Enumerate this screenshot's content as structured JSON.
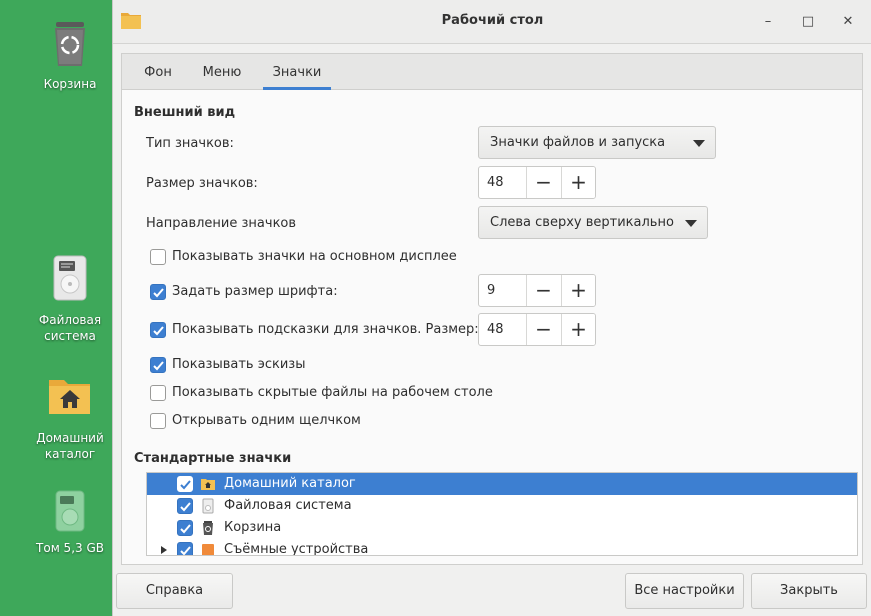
{
  "desktop": {
    "icons": [
      {
        "label": "Корзина",
        "icon": "trash-icon"
      },
      {
        "label": "Файловая система",
        "icon": "drive-icon"
      },
      {
        "label": "Домашний каталог",
        "icon": "home-folder-icon"
      },
      {
        "label": "Том 5,3 GB",
        "icon": "volume-icon"
      }
    ]
  },
  "window": {
    "title": "Рабочий стол",
    "controls": {
      "minimize": "–",
      "maximize": "□",
      "close": "✕"
    },
    "tabs": [
      {
        "label": "Фон",
        "active": false
      },
      {
        "label": "Меню",
        "active": false
      },
      {
        "label": "Значки",
        "active": true
      }
    ],
    "appearance": {
      "title": "Внешний вид",
      "icon_type_label": "Тип значков:",
      "icon_type_value": "Значки файлов и запуска",
      "icon_size_label": "Размер значков:",
      "icon_size_value": "48",
      "direction_label": "Направление значков",
      "direction_value": "Слева сверху вертикально",
      "checks": [
        {
          "label": "Показывать значки на основном дисплее",
          "checked": false
        },
        {
          "label": "Задать размер шрифта:",
          "checked": true,
          "value": "9"
        },
        {
          "label": "Показывать подсказки для значков. Размер:",
          "checked": true,
          "value": "48"
        },
        {
          "label": "Показывать эскизы",
          "checked": true
        },
        {
          "label": "Показывать скрытые файлы на рабочем столе",
          "checked": false
        },
        {
          "label": "Открывать одним щелчком",
          "checked": false
        }
      ]
    },
    "standard_icons": {
      "title": "Стандартные значки",
      "items": [
        {
          "label": "Домашний каталог",
          "checked": true,
          "selected": true,
          "icon": "home-folder-icon"
        },
        {
          "label": "Файловая система",
          "checked": true,
          "selected": false,
          "icon": "drive-icon"
        },
        {
          "label": "Корзина",
          "checked": true,
          "selected": false,
          "icon": "trash-icon"
        },
        {
          "label": "Съёмные устройства",
          "checked": true,
          "selected": false,
          "icon": "removable-drive-icon"
        }
      ]
    },
    "buttons": {
      "help": "Справка",
      "all_settings": "Все настройки",
      "close": "Закрыть"
    },
    "spin_minus": "−",
    "spin_plus": "+",
    "colors": {
      "accent": "#3d7fd1",
      "desktop_bg": "#3ea85a"
    }
  }
}
